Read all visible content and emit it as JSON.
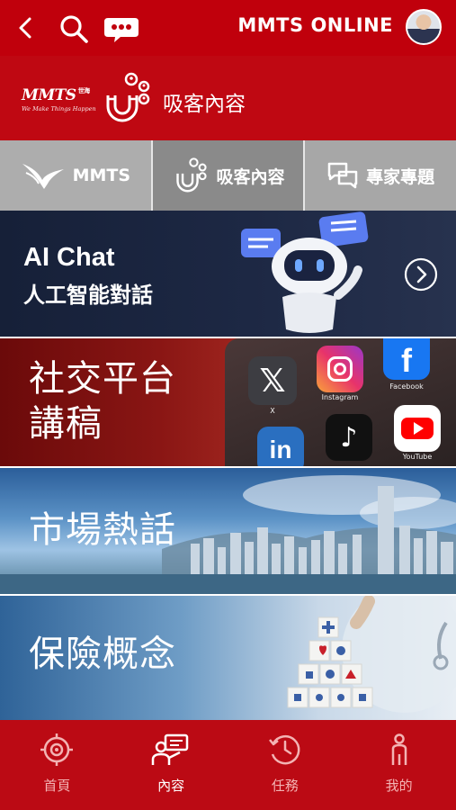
{
  "topbar": {
    "title": "MMTS ONLINE"
  },
  "header": {
    "brand_logo": "MMTS",
    "brand_logo_suffix": "世海",
    "brand_tagline": "We Make Things Happen",
    "section_title": "吸客內容"
  },
  "tabs": [
    {
      "label": "MMTS",
      "icon": "eagle-logo-icon"
    },
    {
      "label": "吸客內容",
      "icon": "magnet-people-icon",
      "selected": true
    },
    {
      "label": "專家專題",
      "icon": "chat-bubbles-icon"
    }
  ],
  "banners": {
    "ai_chat": {
      "title": "AI Chat",
      "subtitle": "人工智能對話"
    },
    "social": {
      "title_line1": "社交平台",
      "title_line2": "講稿",
      "apps": [
        "X",
        "Instagram",
        "Facebook",
        "YouTube"
      ]
    },
    "market": {
      "title": "市場熱話"
    },
    "insurance": {
      "title": "保險概念"
    }
  },
  "bottom_nav": [
    {
      "label": "首頁",
      "icon": "target-home-icon"
    },
    {
      "label": "內容",
      "icon": "content-person-icon",
      "active": true
    },
    {
      "label": "任務",
      "icon": "clock-history-icon"
    },
    {
      "label": "我的",
      "icon": "person-icon"
    }
  ],
  "colors": {
    "primary_red": "#c0000c",
    "tab_gray": "#adadad",
    "tab_selected_gray": "#8a8a8a",
    "ai_navy": "#1d2844"
  }
}
